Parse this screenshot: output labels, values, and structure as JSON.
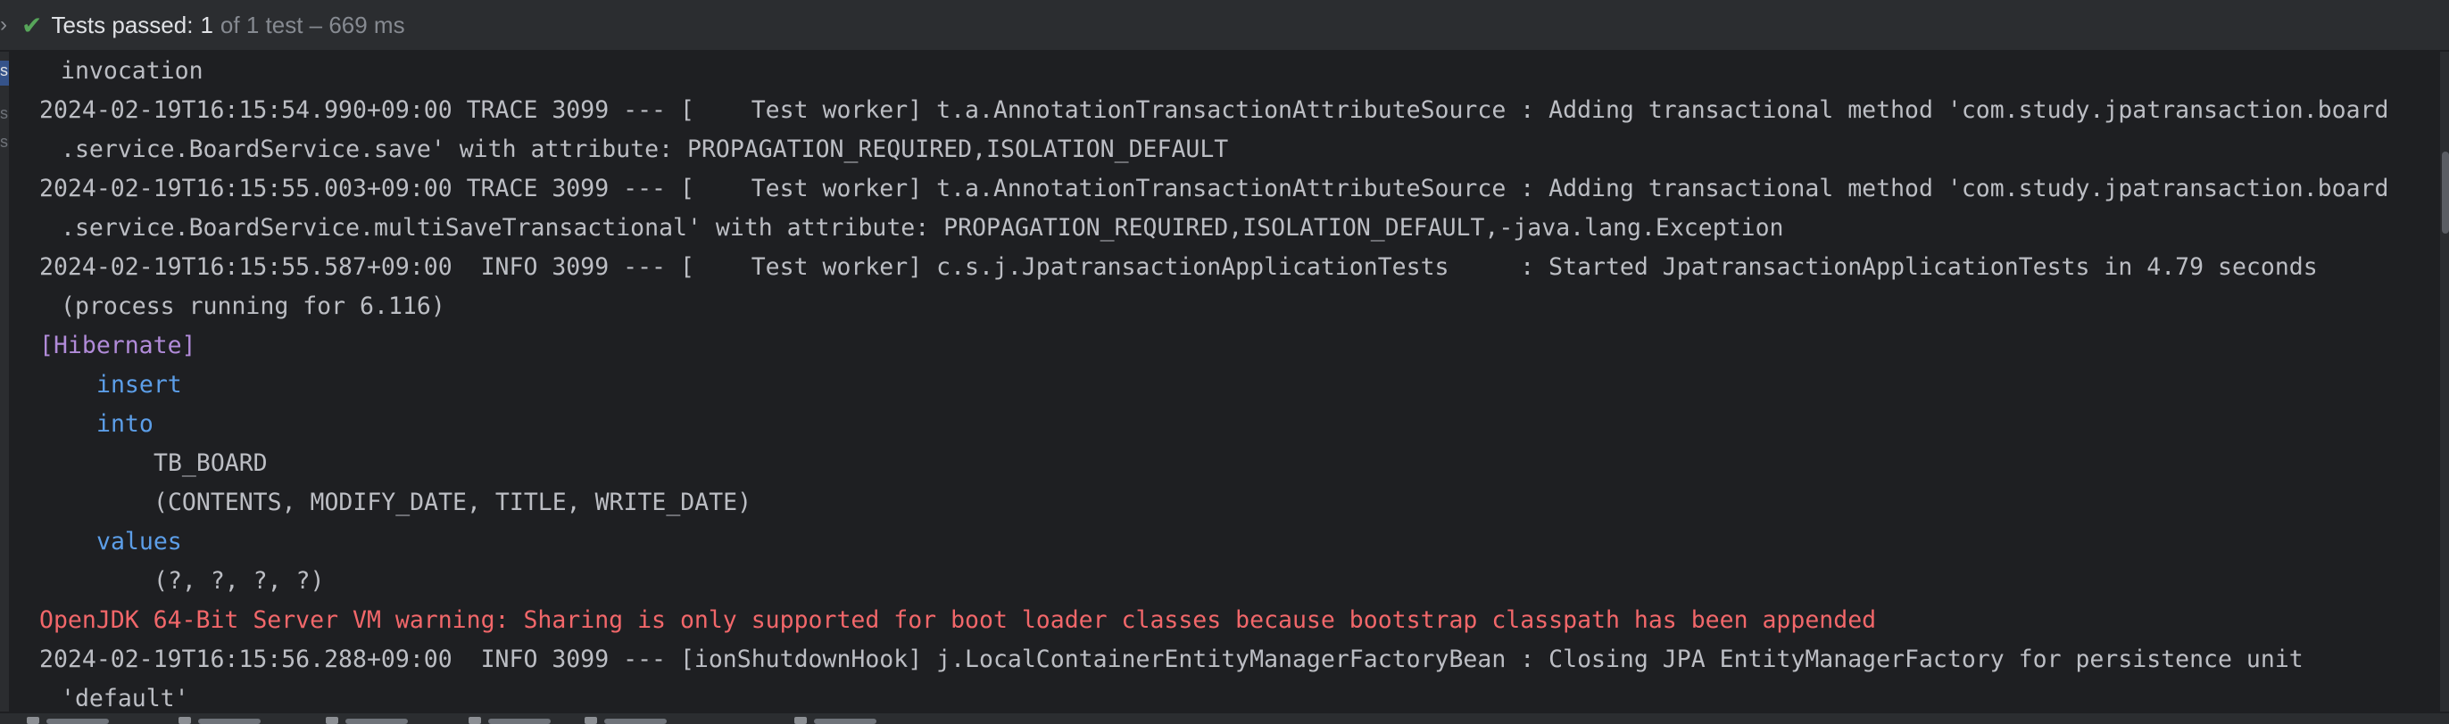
{
  "status_bar": {
    "prefix": "Tests passed:",
    "passed": "1",
    "detail": "of 1 test – 669 ms"
  },
  "console": {
    "lines": [
      "invocation",
      "2024-02-19T16:15:54.990+09:00 TRACE 3099 --- [    Test worker] t.a.AnnotationTransactionAttributeSource : Adding transactional method 'com.study.jpatransaction.board",
      ".service.BoardService.save' with attribute: PROPAGATION_REQUIRED,ISOLATION_DEFAULT",
      "2024-02-19T16:15:55.003+09:00 TRACE 3099 --- [    Test worker] t.a.AnnotationTransactionAttributeSource : Adding transactional method 'com.study.jpatransaction.board",
      ".service.BoardService.multiSaveTransactional' with attribute: PROPAGATION_REQUIRED,ISOLATION_DEFAULT,-java.lang.Exception",
      "2024-02-19T16:15:55.587+09:00  INFO 3099 --- [    Test worker] c.s.j.JpatransactionApplicationTests     : Started JpatransactionApplicationTests in 4.79 seconds",
      "(process running for 6.116)",
      "[Hibernate]",
      "insert",
      "into",
      "TB_BOARD",
      "(CONTENTS, MODIFY_DATE, TITLE, WRITE_DATE)",
      "values",
      "(?, ?, ?, ?)",
      "OpenJDK 64-Bit Server VM warning: Sharing is only supported for boot loader classes because bootstrap classpath has been appended",
      "2024-02-19T16:15:56.288+09:00  INFO 3099 --- [ionShutdownHook] j.LocalContainerEntityManagerFactoryBean : Closing JPA EntityManagerFactory for persistence unit",
      "'default'"
    ]
  },
  "colors": {
    "console_bg": "#1e1f22",
    "panel_bg": "#2b2d30",
    "text": "#bcbec4",
    "hibernate": "#b18bd9",
    "sql_keyword": "#5c9ee8",
    "warning": "#f2676a",
    "pass_check": "#57a55a"
  },
  "icons": [
    "chevron-right-icon",
    "check-icon"
  ]
}
